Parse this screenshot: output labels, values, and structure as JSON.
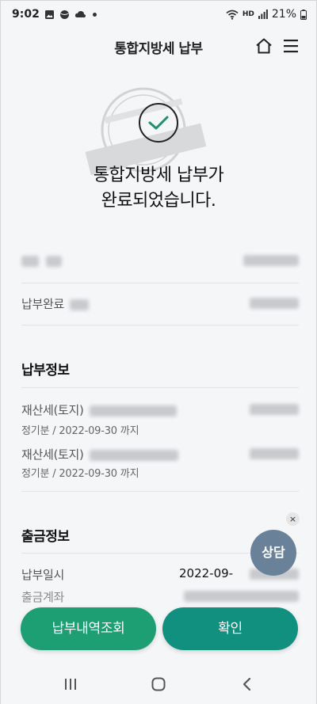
{
  "status_bar": {
    "time": "9:02",
    "battery": "21%",
    "network": "HD"
  },
  "header": {
    "title": "통합지방세 납부"
  },
  "hero": {
    "line1": "통합지방세 납부가",
    "line2": "완료되었습니다."
  },
  "summary": {
    "row2_label": "납부완료"
  },
  "payment_info": {
    "title": "납부정보",
    "items": [
      {
        "label": "재산세(토지)",
        "period": "정기분 / 2022-09-30 까지"
      },
      {
        "label": "재산세(토지)",
        "period": "정기분 / 2022-09-30 까지"
      }
    ]
  },
  "withdraw_info": {
    "title": "출금정보",
    "rows": [
      {
        "label": "납부일시",
        "value": "2022-09-"
      },
      {
        "label": "출금계좌",
        "value": ""
      }
    ]
  },
  "chat": {
    "label": "상담",
    "close": "×"
  },
  "buttons": {
    "history": "납부내역조회",
    "confirm": "확인"
  },
  "colors": {
    "history_btn": "#1e9e73",
    "confirm_btn": "#12907f",
    "chat_btn": "#6a8299",
    "check": "#1f8f6e"
  }
}
